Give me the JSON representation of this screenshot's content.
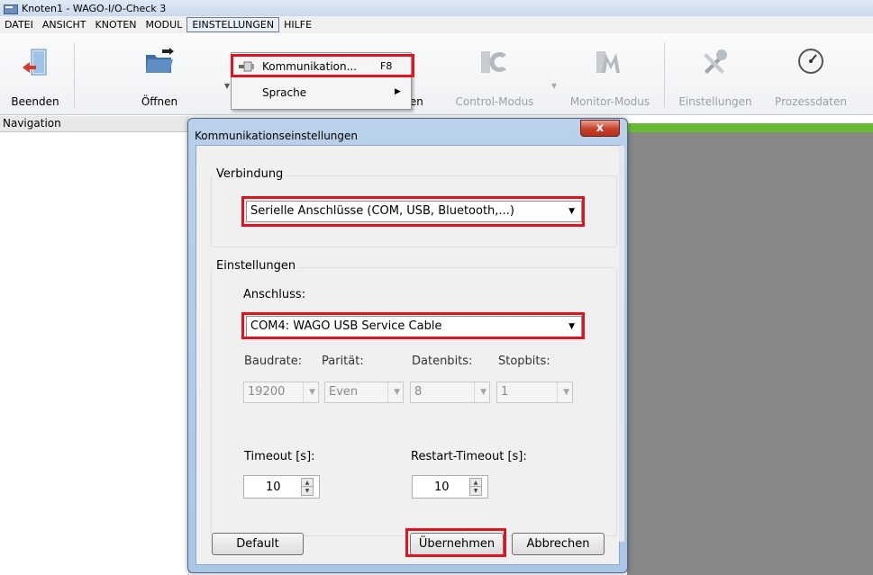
{
  "window": {
    "title": "Knoten1 - WAGO-I/O-Check 3"
  },
  "menubar": {
    "items": [
      "DATEI",
      "ANSICHT",
      "KNOTEN",
      "MODUL",
      "EINSTELLUNGEN",
      "HILFE"
    ]
  },
  "toolbar": {
    "beenden": "Beenden",
    "oeffnen": "Öffnen",
    "partial": "ren",
    "control": "Control-Modus",
    "monitor": "Monitor-Modus",
    "einstellungen": "Einstellungen",
    "prozessdaten": "Prozessdaten"
  },
  "dropdown": {
    "kommunikation": "Kommunikation...",
    "kommunikation_shortcut": "F8",
    "sprache": "Sprache"
  },
  "navigation": {
    "header": "Navigation"
  },
  "dialog": {
    "title": "Kommunikationseinstellungen",
    "close": "x",
    "verbindung": {
      "title": "Verbindung",
      "selected": "Serielle Anschlüsse (COM, USB, Bluetooth,...)"
    },
    "einstellungen": {
      "title": "Einstellungen",
      "anschluss_label": "Anschluss:",
      "anschluss_value": "COM4: WAGO USB Service Cable",
      "baudrate_label": "Baudrate:",
      "paritaet_label": "Parität:",
      "datenbits_label": "Datenbits:",
      "stopbits_label": "Stopbits:",
      "baudrate_value": "19200",
      "paritaet_value": "Even",
      "datenbits_value": "8",
      "stopbits_value": "1",
      "timeout_label": "Timeout [s]:",
      "timeout_value": "10",
      "restart_label": "Restart-Timeout [s]:",
      "restart_value": "10"
    },
    "buttons": {
      "default": "Default",
      "uebernehmen": "Übernehmen",
      "abbrechen": "Abbrechen"
    }
  },
  "colors": {
    "highlight": "#e0141e",
    "green_bar": "#66bb33"
  }
}
